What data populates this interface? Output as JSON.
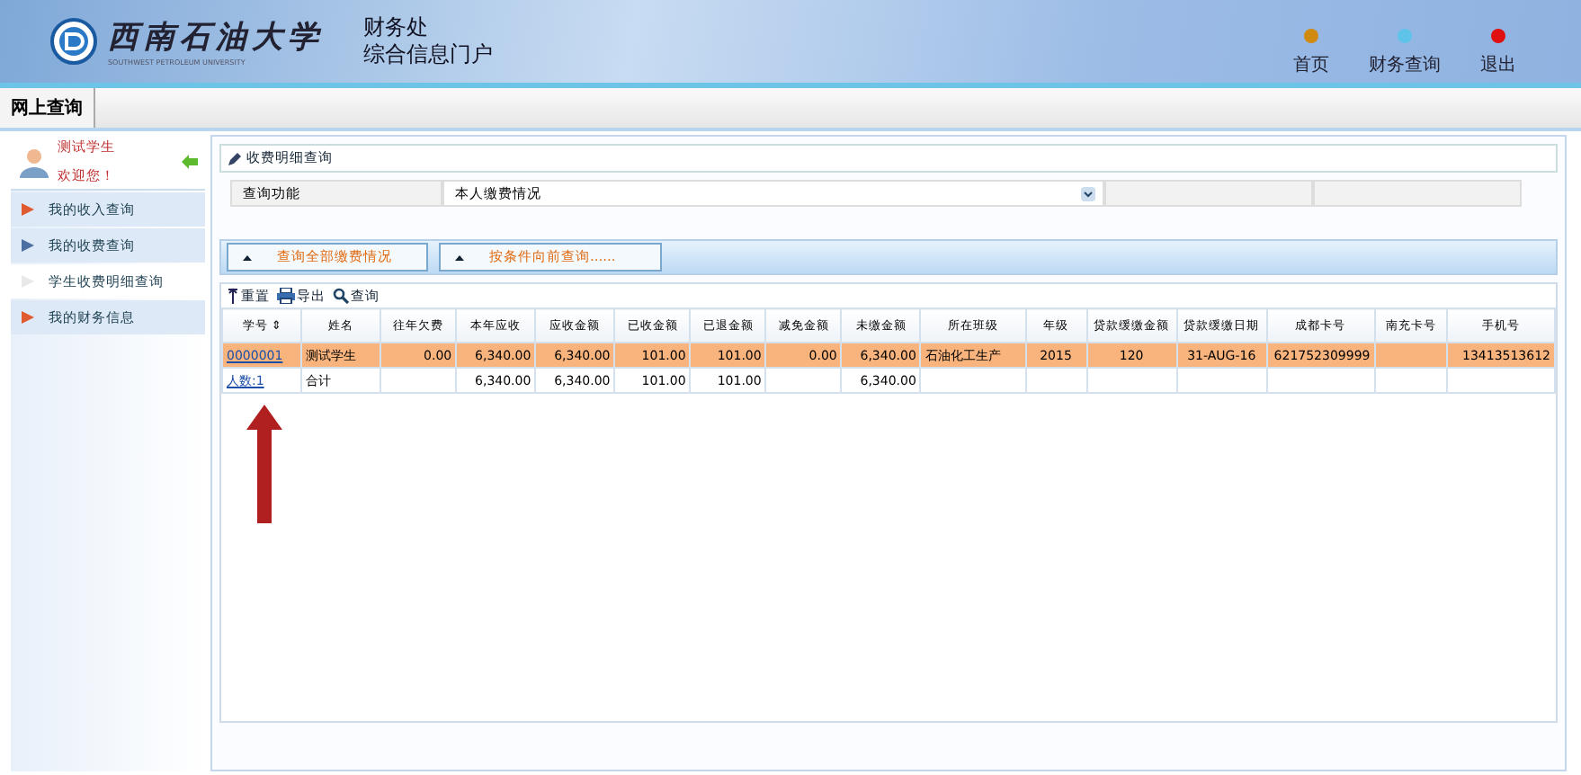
{
  "header": {
    "logo_text": "西南石油大学",
    "logo_subtext": "SOUTHWEST PETROLEUM UNIVERSITY",
    "title_lines": [
      "财务处",
      "综合信息门户"
    ],
    "nav": [
      {
        "label": "首页",
        "color": "#d08a10"
      },
      {
        "label": "财务查询",
        "color": "#5ec3e8"
      },
      {
        "label": "退出",
        "color": "#e01010"
      }
    ]
  },
  "tabs": [
    {
      "label": "网上查询",
      "selected": true
    }
  ],
  "sidebar": {
    "user_name": "测试学生",
    "greeting": "欢迎您！",
    "items": [
      {
        "label": "我的收入查询",
        "selected": false,
        "color": "#e05a30"
      },
      {
        "label": "我的收费查询",
        "selected": false,
        "color": "#4a6fa0"
      },
      {
        "label": "学生收费明细查询",
        "selected": true,
        "color": "#e8e8e8"
      },
      {
        "label": "我的财务信息",
        "selected": false,
        "color": "#e05a30"
      }
    ]
  },
  "panel": {
    "title": "收费明细查询",
    "query_label": "查询功能",
    "query_value": "本人缴费情况",
    "accordion": [
      {
        "label": "查询全部缴费情况"
      },
      {
        "label": "按条件向前查询......"
      }
    ],
    "toolbar": [
      {
        "label": "重置",
        "kind": "reset"
      },
      {
        "label": "导出",
        "kind": "export"
      },
      {
        "label": "查询",
        "kind": "search"
      }
    ],
    "table": {
      "columns": [
        "学号 ⇕",
        "姓名",
        "往年欠费",
        "本年应收",
        "应收金额",
        "已收金额",
        "已退金额",
        "减免金额",
        "未缴金额",
        "所在班级",
        "年级",
        "贷款缓缴金额",
        "贷款缓缴日期",
        "成都卡号",
        "南充卡号",
        "手机号"
      ],
      "rows": [
        {
          "selected": true,
          "cells": [
            "0000001",
            "测试学生",
            "0.00",
            "6,340.00",
            "6,340.00",
            "101.00",
            "101.00",
            "0.00",
            "6,340.00",
            "石油化工生产",
            "2015",
            "120",
            "31-AUG-16",
            "621752309999",
            "",
            "13413513612"
          ]
        },
        {
          "selected": false,
          "cells": [
            "人数:1",
            "合计",
            "",
            "6,340.00",
            "6,340.00",
            "101.00",
            "101.00",
            "",
            "6,340.00",
            "",
            "",
            "",
            "",
            "",
            "",
            ""
          ]
        }
      ]
    }
  }
}
